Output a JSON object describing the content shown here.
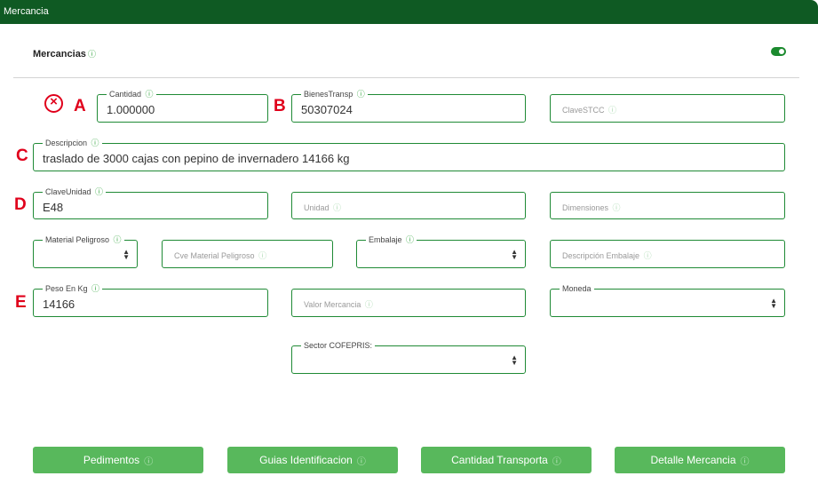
{
  "header": {
    "title": "Mercancia"
  },
  "section": {
    "label": "Mercancias",
    "toggle_on": true
  },
  "markers": {
    "a": "A",
    "b": "B",
    "c": "C",
    "d": "D",
    "e": "E"
  },
  "fields": {
    "cantidad": {
      "label": "Cantidad",
      "value": "1.000000"
    },
    "bienes_transp": {
      "label": "BienesTransp",
      "value": "50307024"
    },
    "clave_stcc": {
      "placeholder": "ClaveSTCC"
    },
    "descripcion": {
      "label": "Descripcion",
      "value": "traslado de 3000 cajas con pepino de invernadero 14166 kg"
    },
    "clave_unidad": {
      "label": "ClaveUnidad",
      "value": "E48"
    },
    "unidad": {
      "placeholder": "Unidad"
    },
    "dimensiones": {
      "placeholder": "Dimensiones"
    },
    "material_peligroso": {
      "label": "Material Peligroso",
      "value": ""
    },
    "cve_material_peligroso": {
      "placeholder": "Cve Material Peligroso"
    },
    "embalaje": {
      "label": "Embalaje",
      "value": ""
    },
    "descripcion_embalaje": {
      "placeholder": "Descripción Embalaje"
    },
    "peso_en_kg": {
      "label": "Peso En Kg",
      "value": "14166"
    },
    "valor_mercancia": {
      "placeholder": "Valor Mercancia"
    },
    "moneda": {
      "label": "Moneda",
      "value": ""
    },
    "sector_cofepris": {
      "label": "Sector COFEPRIS:",
      "value": ""
    }
  },
  "buttons": {
    "pedimentos": "Pedimentos",
    "guias": "Guias Identificacion",
    "cantidad_transporta": "Cantidad Transporta",
    "detalle_mercancia": "Detalle Mercancia"
  },
  "icons": {
    "info": "ⓘ",
    "error": "⊗"
  },
  "colors": {
    "header": "#0f5a23",
    "border": "#1f8a35",
    "button": "#58b85c",
    "marker": "#e0001b"
  }
}
